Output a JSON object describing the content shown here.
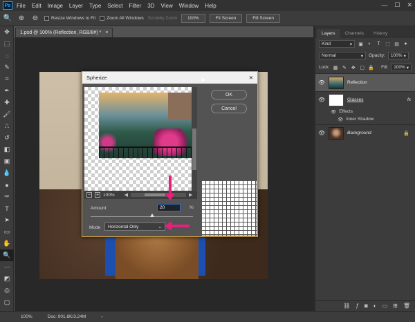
{
  "app": {
    "logo": "Ps"
  },
  "menu": [
    "File",
    "Edit",
    "Image",
    "Layer",
    "Type",
    "Select",
    "Filter",
    "3D",
    "View",
    "Window",
    "Help"
  ],
  "window_controls": [
    "—",
    "☐",
    "✕"
  ],
  "options_bar": {
    "resize_windows": "Resize Windows to Fit",
    "zoom_all": "Zoom All Windows",
    "scrubby_zoom": "Scrubby Zoom",
    "zoom_pct": "100%",
    "fit_screen": "Fit Screen",
    "fill_screen": "Fill Screen"
  },
  "document": {
    "tab_title": "1.psd @ 100% (Reflection, RGB/8#) *",
    "tab_close": "×"
  },
  "status": {
    "zoom": "100%",
    "doc": "Doc: 901.8K/3.24M",
    "arrow": "›"
  },
  "dialog": {
    "title": "Spherize",
    "close": "✕",
    "ok": "OK",
    "cancel": "Cancel",
    "preview_zoom": "100%",
    "amount_label": "Amount",
    "amount_value": "20",
    "amount_unit": "%",
    "amount_slider": 0.6,
    "mode_label": "Mode",
    "mode_value": "Horizontal Only"
  },
  "layers_panel": {
    "tabs": [
      "Layers",
      "Channels",
      "History"
    ],
    "kind": "Kind",
    "blend_mode": "Normal",
    "opacity_label": "Opacity:",
    "opacity_value": "100%",
    "lock_label": "Lock:",
    "fill_label": "Fill:",
    "fill_value": "100%",
    "layers": [
      {
        "name": "Reflection",
        "selected": true
      },
      {
        "name": "Glasses",
        "fx": "fx"
      },
      {
        "name": "Background",
        "lock": "🔒"
      }
    ],
    "effects_label": "Effects",
    "inner_shadow": "Inner Shadow"
  },
  "colors": {
    "accent_pink": "#e8207a",
    "dialog_border": "#d0a040",
    "ps_blue": "#31a8ff"
  }
}
